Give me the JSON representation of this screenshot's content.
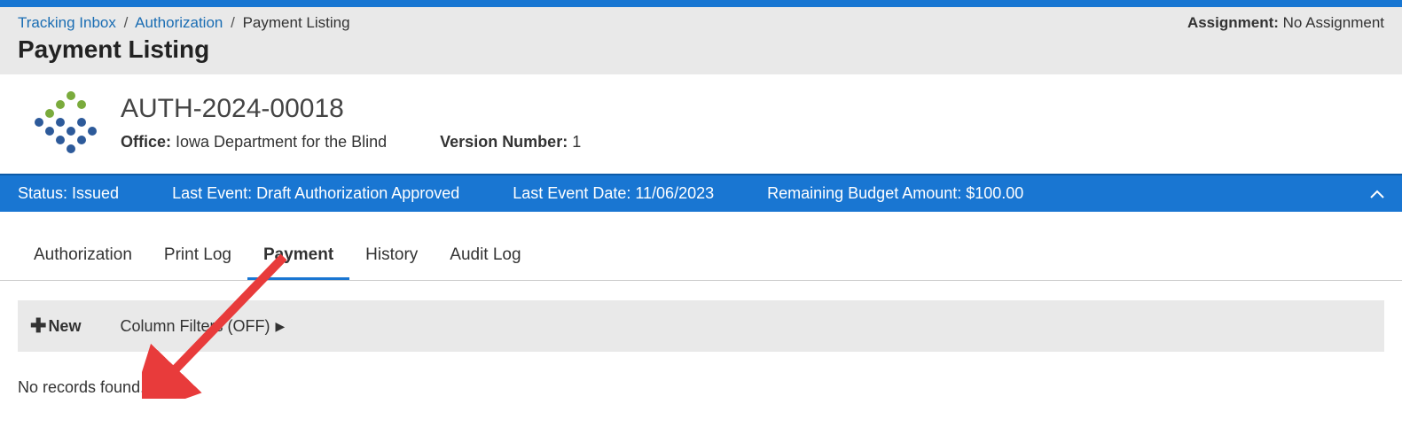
{
  "breadcrumb": {
    "items": [
      "Tracking Inbox",
      "Authorization",
      "Payment Listing"
    ]
  },
  "assignment": {
    "label": "Assignment:",
    "value": "No Assignment"
  },
  "page_title": "Payment Listing",
  "auth": {
    "id": "AUTH-2024-00018",
    "office_label": "Office:",
    "office_value": "Iowa Department for the Blind",
    "version_label": "Version Number:",
    "version_value": "1"
  },
  "status_bar": {
    "status": "Status: Issued",
    "last_event": "Last Event: Draft Authorization Approved",
    "last_event_date": "Last Event Date: 11/06/2023",
    "remaining_budget": "Remaining Budget Amount: $100.00"
  },
  "tabs": [
    "Authorization",
    "Print Log",
    "Payment",
    "History",
    "Audit Log"
  ],
  "active_tab_index": 2,
  "toolbar": {
    "new_label": "New",
    "filters_label": "Column Filters (OFF)"
  },
  "records_msg": "No records found."
}
